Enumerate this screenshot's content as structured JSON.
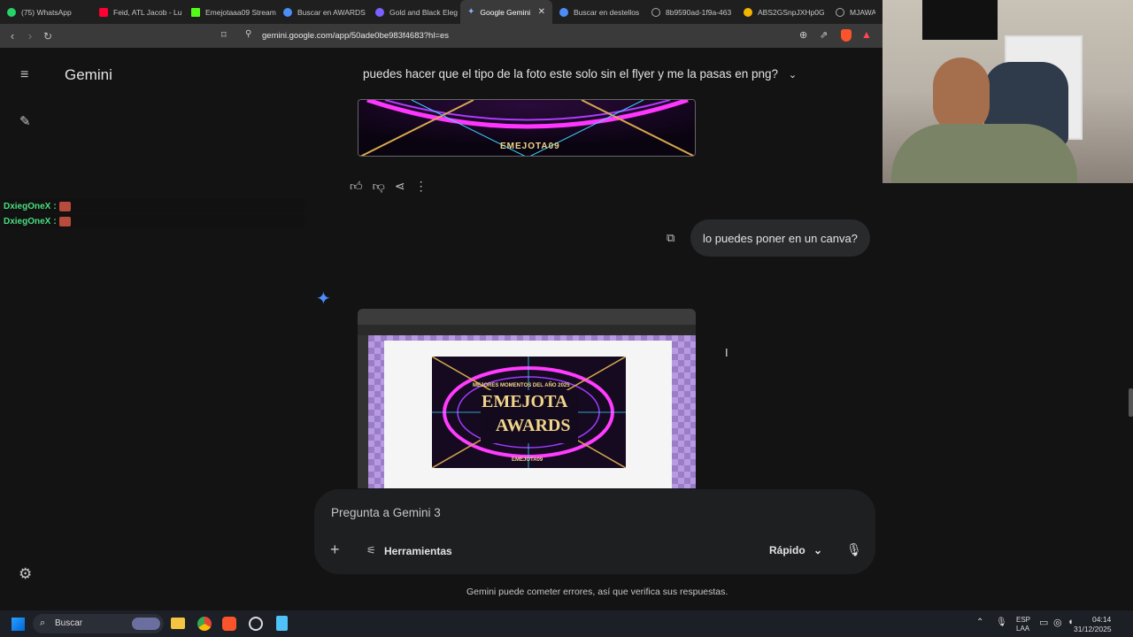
{
  "browser": {
    "tabs": [
      {
        "label": "(75) WhatsApp",
        "color": "#25d366"
      },
      {
        "label": "Feid, ATL Jacob - Lu",
        "color": "#ff0033"
      },
      {
        "label": "Emejotaaa09 Stream",
        "color": "#53fc18"
      },
      {
        "label": "Buscar en AWARDS",
        "color": "#4c8df6"
      },
      {
        "label": "Gold and Black Eleg",
        "color": "#7b61ff"
      },
      {
        "label": "Google Gemini",
        "color": "#8ab4f8"
      },
      {
        "label": "Buscar en destellos",
        "color": "#4c8df6"
      },
      {
        "label": "8b9590ad-1f9a-463",
        "color": "#aaaaaa"
      },
      {
        "label": "ABS2GSnpJXHp0G",
        "color": "#f4b400"
      },
      {
        "label": "MJAWA.pn",
        "color": "#aaaaaa"
      }
    ],
    "url": "gemini.google.com/app/50ade0be983f4683?hl=es"
  },
  "stream_chat": [
    {
      "user": "DxiegOneX",
      "sep": ":"
    },
    {
      "user": "DxiegOneX",
      "sep": ":"
    }
  ],
  "gemini": {
    "app_title": "Gemini",
    "conversation_title": "puedes hacer que el tipo de la foto este solo sin el flyer y me la pasas en png?",
    "user_message": "lo puedes poner en un canva?",
    "flyer_brand": "EMEJOTA09",
    "flyer_subtitle": "MEJORES MOMENTOS DEL AÑO 2025",
    "flyer_title_line1": "EMEJOTA",
    "flyer_title_line2": "AWARDS",
    "prompt_placeholder": "Pregunta a Gemini 3",
    "tools_label": "Herramientas",
    "mode_label": "Rápido",
    "disclaimer": "Gemini puede cometer errores, así que verifica sus respuestas."
  },
  "taskbar": {
    "search_label": "Buscar",
    "lang_line1": "ESP",
    "lang_line2": "LAA",
    "time": "04:14",
    "date": "31/12/2025"
  }
}
